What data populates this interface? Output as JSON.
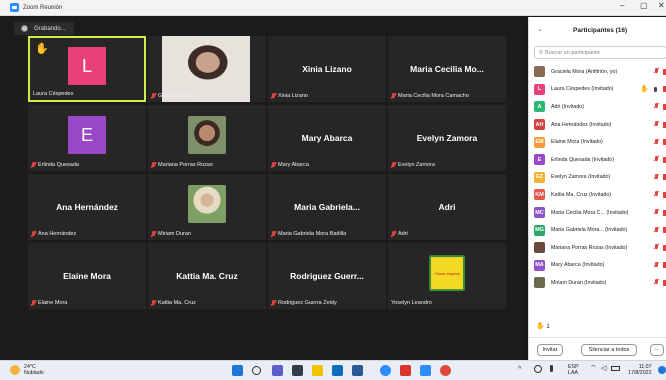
{
  "window": {
    "title": "Zoom Reunión",
    "minimize": "–",
    "maximize": "▢",
    "close": "✕"
  },
  "recording": {
    "label": "Grabando..."
  },
  "tiles": [
    {
      "big": "",
      "label": "Laura Céspedes",
      "muted": false,
      "avatar": "L",
      "avatar_color": "#e7407a",
      "active": true,
      "hand": true
    },
    {
      "big": "",
      "label": "Graciela Mora",
      "muted": true,
      "photo": "woman-glasses-photo"
    },
    {
      "big": "Xinia Lizano",
      "label": "Xinia Lizano",
      "muted": true
    },
    {
      "big": "Maria Cecilia Mo...",
      "label": "Maria Cecilia Mora Camacho",
      "muted": true
    },
    {
      "big": "",
      "label": "Erlinda Quesada",
      "muted": true,
      "avatar": "E",
      "avatar_color": "#9a48c8"
    },
    {
      "big": "",
      "label": "Mariana Porras Rozas",
      "muted": true,
      "photo": "woman-smiling-photo"
    },
    {
      "big": "Mary Abarca",
      "label": "Mary Abarca",
      "muted": true
    },
    {
      "big": "Evelyn Zamora",
      "label": "Evelyn Zamora",
      "muted": true
    },
    {
      "big": "Ana Hernández",
      "label": "Ana Hernández",
      "muted": true
    },
    {
      "big": "",
      "label": "Miriam Duran",
      "muted": true,
      "photo": "woman-outdoor-photo"
    },
    {
      "big": "Maria Gabriela...",
      "label": "Maria Gabriela Mora Badilla",
      "muted": true
    },
    {
      "big": "Adri",
      "label": "Adri",
      "muted": true
    },
    {
      "big": "Elaine Mora",
      "label": "Elaine Mora",
      "muted": true
    },
    {
      "big": "Kattia Ma. Cruz",
      "label": "Kattia Ma. Cruz",
      "muted": true
    },
    {
      "big": "Rodriguez Guerr...",
      "label": "Rodriguez Guerra Zeidy",
      "muted": true
    },
    {
      "big": "",
      "label": "Yoselyn Leandro",
      "muted": false,
      "photo": "flores-logo",
      "logo_text": "Flores tropical"
    }
  ],
  "participants_panel": {
    "title": "Participantes (16)",
    "search_placeholder": "Buscar un participante",
    "items": [
      {
        "initials": "",
        "name": "Graciela Mora (Anfitrión, yo)",
        "color": "#8a6a55",
        "photo": true,
        "status": "host"
      },
      {
        "initials": "L",
        "name": "Laura Céspedes (Invitado)",
        "color": "#e7407a",
        "status": "hand"
      },
      {
        "initials": "A",
        "name": "Adri (Invitado)",
        "color": "#2cb673"
      },
      {
        "initials": "AH",
        "name": "Ana Hernández (Invitado)",
        "color": "#d4423f"
      },
      {
        "initials": "EM",
        "name": "Elaine Mora (Invitado)",
        "color": "#f59a34"
      },
      {
        "initials": "E",
        "name": "Erlinda Quesada (Invitado)",
        "color": "#9a48c8"
      },
      {
        "initials": "EZ",
        "name": "Evelyn Zamora (Invitado)",
        "color": "#f2b232"
      },
      {
        "initials": "KM",
        "name": "Kattia Ma. Cruz (Invitado)",
        "color": "#e4574b"
      },
      {
        "initials": "MC",
        "name": "Maria Cecilia Mora C... (Invitado)",
        "color": "#8e53c6"
      },
      {
        "initials": "MG",
        "name": "Maria Gabriela Mora... (Invitado)",
        "color": "#2ea66b"
      },
      {
        "initials": "",
        "name": "Mariana Porras Rozas (Invitado)",
        "color": "#6b4a3e",
        "photo": true
      },
      {
        "initials": "MA",
        "name": "Mary Abarca (Invitado)",
        "color": "#8e53c6"
      },
      {
        "initials": "",
        "name": "Miriam Duran (Invitado)",
        "color": "#6b6a4e",
        "photo": true
      }
    ],
    "raised_hands": "1",
    "invite_label": "Invitar",
    "mute_all_label": "Silenciar a todos",
    "more_label": "···"
  },
  "taskbar": {
    "temp": "24°C",
    "weather": "Nublado",
    "lang": "ESP",
    "lang2": "LAA",
    "time": "11:07",
    "date": "17/8/2022"
  }
}
